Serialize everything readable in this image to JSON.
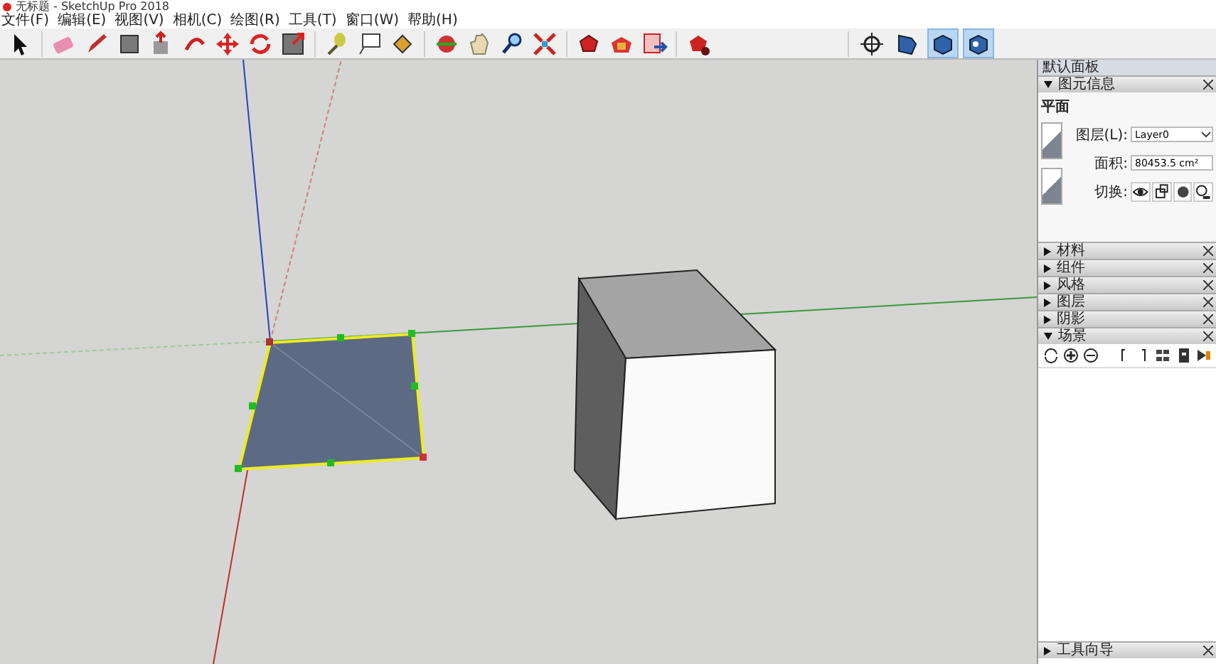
{
  "window": {
    "title": "无标题 - SketchUp Pro 2018"
  },
  "menu": [
    "文件(F)",
    "编辑(E)",
    "视图(V)",
    "相机(C)",
    "绘图(R)",
    "工具(T)",
    "窗口(W)",
    "帮助(H)"
  ],
  "view_buttons": [
    {
      "selected": false
    },
    {
      "selected": false
    },
    {
      "selected": true
    },
    {
      "selected": true
    }
  ],
  "tray": {
    "title": "默认面板",
    "sections": [
      {
        "title": "图元信息",
        "expanded": true,
        "kind": "entity"
      },
      {
        "title": "材料",
        "expanded": false
      },
      {
        "title": "组件",
        "expanded": false
      },
      {
        "title": "风格",
        "expanded": false
      },
      {
        "title": "图层",
        "expanded": false
      },
      {
        "title": "阴影",
        "expanded": false
      },
      {
        "title": "场景",
        "expanded": true,
        "kind": "scenes"
      }
    ],
    "entity": {
      "type": "平面",
      "layer_label": "图层(L):",
      "layer_value": "Layer0",
      "area_label": "面积:",
      "area_value": "80453.5 cm²",
      "toggle_label": "切换:"
    },
    "bottom_section": {
      "title": "工具向导",
      "expanded": false
    }
  }
}
